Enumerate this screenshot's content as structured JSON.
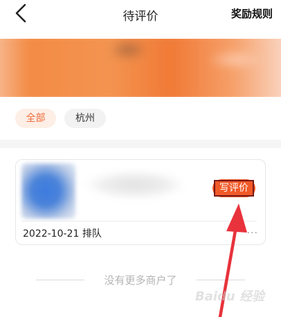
{
  "header": {
    "title": "待评价",
    "rules_label": "奖励规则"
  },
  "filters": [
    {
      "label": "全部"
    },
    {
      "label": "杭州"
    }
  ],
  "card": {
    "date": "2022-10-21",
    "status": "排队",
    "write_review_label": "写评价",
    "more_label": "..."
  },
  "footer": {
    "no_more_text": "没有更多商户了"
  },
  "watermark": {
    "text": "Baidu 经验"
  },
  "colors": {
    "accent": "#f15a28",
    "chip_active_bg": "#fdeee6",
    "annotation_arrow": "#e8323c"
  }
}
